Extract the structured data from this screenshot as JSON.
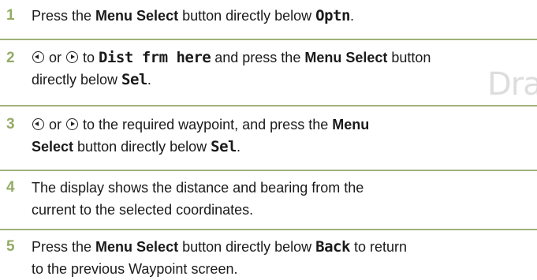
{
  "watermark": "Dra",
  "steps": [
    {
      "number": "1",
      "t1": "Press the ",
      "menu": "Menu Select",
      "t2": " button directly below ",
      "lcd": "Optn",
      "t3": "."
    },
    {
      "number": "2",
      "t_or": " or ",
      "t_to": " to ",
      "lcd1": "Dist frm here",
      "t_mid": " and press the ",
      "menu": "Menu Select",
      "t_btn": " button",
      "line2": "directly below ",
      "lcd2": "Sel",
      "t3": "."
    },
    {
      "number": "3",
      "t_or": " or ",
      "t_to": " to the required waypoint, and press the ",
      "menu1": "Menu",
      "menu2": "Select",
      "t_btn": " button directly below ",
      "lcd": "Sel",
      "t3": "."
    },
    {
      "number": "4",
      "line1": "The display shows the distance and bearing from the",
      "line2": "current to the selected coordinates."
    },
    {
      "number": "5",
      "t1": "Press the ",
      "menu": "Menu Select",
      "t2": " button directly below ",
      "lcd": "Back",
      "t3": " to return",
      "line2": "to the previous Waypoint screen."
    }
  ],
  "icons": {
    "scroll_left": "scroll-left-icon",
    "scroll_right": "scroll-right-icon"
  },
  "colors": {
    "step_number": "#93ab66",
    "divider": "#9fb27a",
    "text": "#1a1a1a"
  }
}
